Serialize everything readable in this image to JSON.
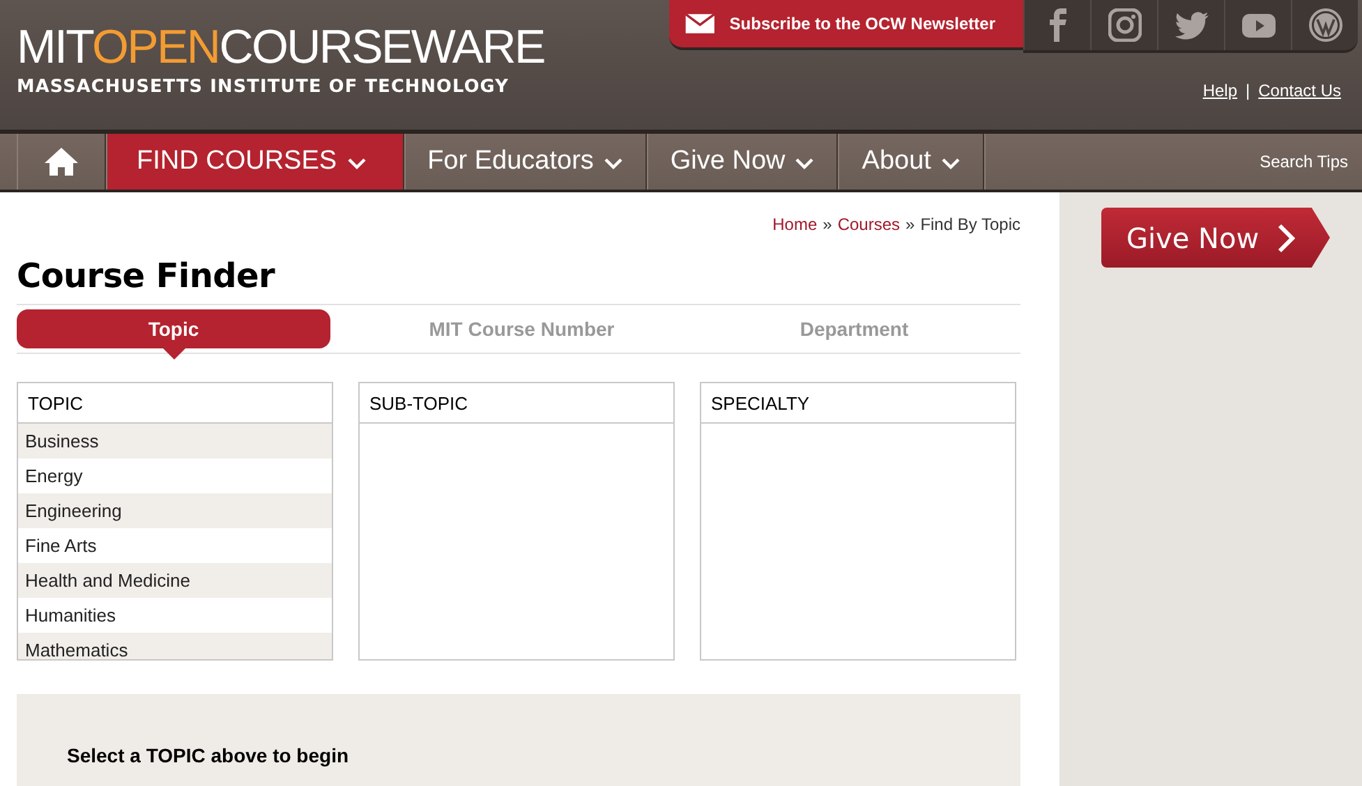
{
  "header": {
    "logo_parts": [
      {
        "text": "MIT",
        "highlighted": false
      },
      {
        "text": "OPEN",
        "highlighted": true
      },
      {
        "text": "COURSEWARE",
        "highlighted": false
      }
    ],
    "logo_subtitle": "MASSACHUSETTS INSTITUTE OF TECHNOLOGY",
    "newsletter": "Subscribe to the OCW Newsletter",
    "links": [
      {
        "text": "Help",
        "kind": "link"
      },
      {
        "text": "|",
        "kind": "separator"
      },
      {
        "text": "Contact Us",
        "kind": "link"
      }
    ]
  },
  "nav": {
    "items": [
      {
        "label": "FIND COURSES",
        "selected": true
      },
      {
        "label": "For Educators",
        "selected": false
      },
      {
        "label": "Give Now",
        "selected": false
      },
      {
        "label": "About",
        "selected": false
      }
    ],
    "search_tips": "Search Tips"
  },
  "breadcrumb": [
    {
      "text": "Home",
      "kind": "link"
    },
    {
      "text": "»",
      "kind": "separator"
    },
    {
      "text": "Courses",
      "kind": "link"
    },
    {
      "text": "»",
      "kind": "separator"
    },
    {
      "text": "Find By Topic",
      "kind": "current"
    }
  ],
  "title": "Course Finder",
  "tabs": [
    {
      "label": "Topic",
      "selected": true
    },
    {
      "label": "MIT Course Number",
      "selected": false
    },
    {
      "label": "Department",
      "selected": false
    }
  ],
  "lists": [
    {
      "heading": "TOPIC",
      "items": [
        "Business",
        "Energy",
        "Engineering",
        "Fine Arts",
        "Health and Medicine",
        "Humanities",
        "Mathematics"
      ]
    },
    {
      "heading": "SUB-TOPIC"
    },
    {
      "heading": "SPECIALTY"
    }
  ],
  "prompt": "Select a TOPIC above to begin",
  "sidebar": {
    "give_button": "Give Now"
  }
}
